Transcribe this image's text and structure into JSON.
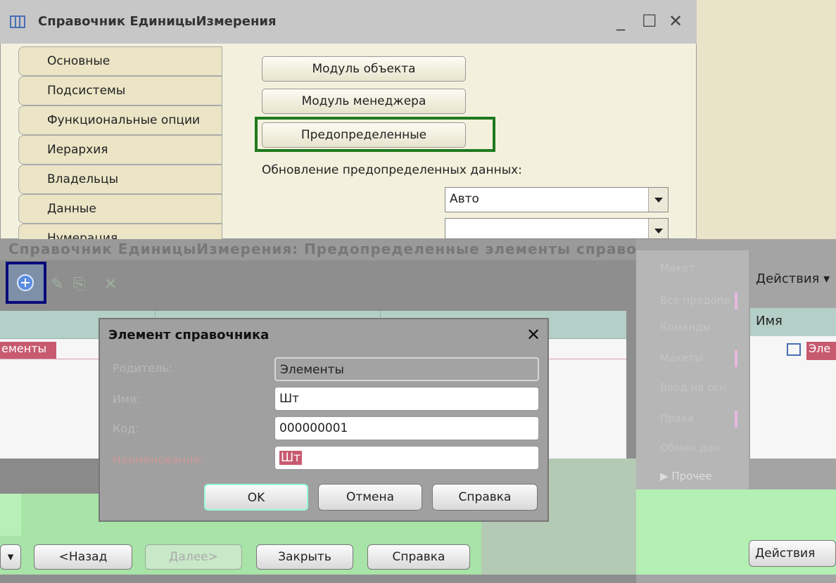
{
  "top_window": {
    "title": "Справочник ЕдиницыИзмерения",
    "minimize": "_",
    "maximize": "☐",
    "close": "✕",
    "tabs": [
      {
        "label": "Основные"
      },
      {
        "label": "Подсистемы"
      },
      {
        "label": "Функциональные опции"
      },
      {
        "label": "Иерархия"
      },
      {
        "label": "Владельцы"
      },
      {
        "label": "Данные"
      },
      {
        "label": "Нумерация"
      }
    ],
    "buttons": {
      "object_module": "Модуль объекта",
      "manager_module": "Модуль менеджера",
      "predefined": "Предопределенные"
    },
    "update_label": "Обновление предопределенных данных:",
    "update_value": "Авто"
  },
  "bottom_window": {
    "title": "Справочник ЕдиницыИзмерения: Предопределенные элементы справочника",
    "list_first_row": "ементы",
    "nav": {
      "back": "<Назад",
      "next": "Далее>",
      "close": "Закрыть",
      "help": "Справка"
    }
  },
  "right_panel": {
    "items": [
      "Макет",
      "Все предопр",
      "Команды",
      "Макеты",
      "Ввод на осн",
      "Права",
      "Обмен дан",
      "Прочее"
    ],
    "actions": "Действия ▾",
    "column_name": "Имя",
    "element_cell": "Эле",
    "bottom_actions": "Действия"
  },
  "dialog": {
    "title": "Элемент справочника",
    "close": "✕",
    "fields": {
      "parent_label": "Родитель:",
      "parent_value": "Элементы",
      "name_label": "Имя:",
      "name_value": "Шт",
      "code_label": "Код:",
      "code_value": "000000001",
      "description_label": "Наименование:",
      "description_value": "Шт"
    },
    "buttons": {
      "ok": "OK",
      "cancel": "Отмена",
      "help": "Справка"
    }
  }
}
